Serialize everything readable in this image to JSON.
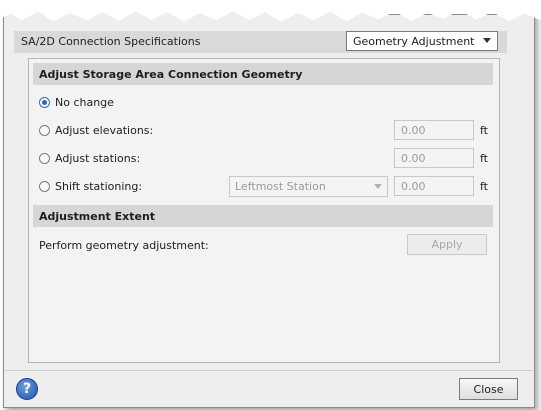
{
  "header": {
    "title": "SA/2D Connection Specifications",
    "mode_select": "Geometry Adjustment"
  },
  "geometry_section": {
    "title": "Adjust Storage Area Connection Geometry",
    "options": [
      {
        "label": "No change",
        "checked": true
      },
      {
        "label": "Adjust elevations:",
        "value": "0.00",
        "unit": "ft"
      },
      {
        "label": "Adjust stations:",
        "value": "0.00",
        "unit": "ft"
      },
      {
        "label": "Shift stationing:",
        "station_select": "Leftmost Station",
        "value": "0.00",
        "unit": "ft"
      }
    ]
  },
  "extent_section": {
    "title": "Adjustment Extent",
    "label": "Perform geometry adjustment:",
    "apply_label": "Apply"
  },
  "footer": {
    "help_glyph": "?",
    "close_label": "Close"
  },
  "colors": {
    "accent": "#2a63b8",
    "section_bar": "#d6d6d6"
  }
}
